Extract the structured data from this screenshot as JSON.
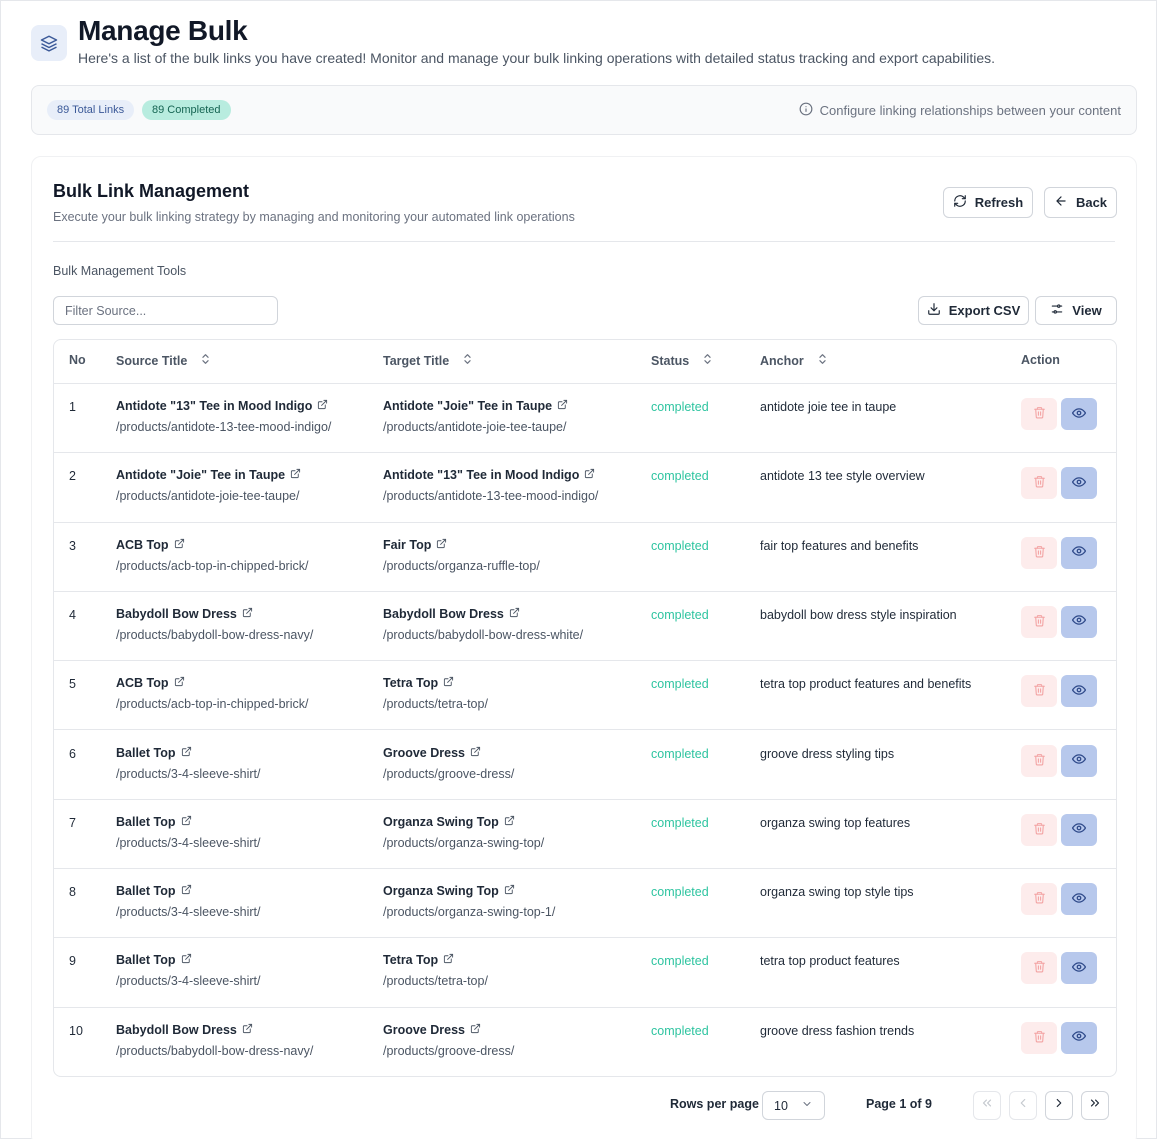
{
  "header": {
    "title": "Manage Bulk",
    "subtitle": "Here's a list of the bulk links you have created! Monitor and manage your bulk linking operations with detailed status tracking and export capabilities.",
    "icon": "layers-icon"
  },
  "stats": {
    "total_badge": "89 Total Links",
    "completed_badge": "89 Completed",
    "note": "Configure linking relationships between your content"
  },
  "card": {
    "title": "Bulk Link Management",
    "subtitle": "Execute your bulk linking strategy by managing and monitoring your automated link operations",
    "refresh_label": "Refresh",
    "back_label": "Back",
    "tools_label": "Bulk Management Tools",
    "filter_placeholder": "Filter Source...",
    "export_label": "Export CSV",
    "view_label": "View"
  },
  "table": {
    "columns": {
      "no": "No",
      "source": "Source Title",
      "target": "Target Title",
      "status": "Status",
      "anchor": "Anchor",
      "action": "Action"
    },
    "rows": [
      {
        "no": "1",
        "source_title": "Antidote \"13\" Tee in Mood Indigo",
        "source_url": "/products/antidote-13-tee-mood-indigo/",
        "target_title": "Antidote \"Joie\" Tee in Taupe",
        "target_url": "/products/antidote-joie-tee-taupe/",
        "status": "completed",
        "anchor": "antidote joie tee in taupe"
      },
      {
        "no": "2",
        "source_title": "Antidote \"Joie\" Tee in Taupe",
        "source_url": "/products/antidote-joie-tee-taupe/",
        "target_title": "Antidote \"13\" Tee in Mood Indigo",
        "target_url": "/products/antidote-13-tee-mood-indigo/",
        "status": "completed",
        "anchor": "antidote 13 tee style overview"
      },
      {
        "no": "3",
        "source_title": "ACB Top",
        "source_url": "/products/acb-top-in-chipped-brick/",
        "target_title": "Fair Top",
        "target_url": "/products/organza-ruffle-top/",
        "status": "completed",
        "anchor": "fair top features and benefits"
      },
      {
        "no": "4",
        "source_title": "Babydoll Bow Dress",
        "source_url": "/products/babydoll-bow-dress-navy/",
        "target_title": "Babydoll Bow Dress",
        "target_url": "/products/babydoll-bow-dress-white/",
        "status": "completed",
        "anchor": "babydoll bow dress style inspiration"
      },
      {
        "no": "5",
        "source_title": "ACB Top",
        "source_url": "/products/acb-top-in-chipped-brick/",
        "target_title": "Tetra Top",
        "target_url": "/products/tetra-top/",
        "status": "completed",
        "anchor": "tetra top product features and benefits"
      },
      {
        "no": "6",
        "source_title": "Ballet Top",
        "source_url": "/products/3-4-sleeve-shirt/",
        "target_title": "Groove Dress",
        "target_url": "/products/groove-dress/",
        "status": "completed",
        "anchor": "groove dress styling tips"
      },
      {
        "no": "7",
        "source_title": "Ballet Top",
        "source_url": "/products/3-4-sleeve-shirt/",
        "target_title": "Organza Swing Top",
        "target_url": "/products/organza-swing-top/",
        "status": "completed",
        "anchor": "organza swing top features"
      },
      {
        "no": "8",
        "source_title": "Ballet Top",
        "source_url": "/products/3-4-sleeve-shirt/",
        "target_title": "Organza Swing Top",
        "target_url": "/products/organza-swing-top-1/",
        "status": "completed",
        "anchor": "organza swing top style tips"
      },
      {
        "no": "9",
        "source_title": "Ballet Top",
        "source_url": "/products/3-4-sleeve-shirt/",
        "target_title": "Tetra Top",
        "target_url": "/products/tetra-top/",
        "status": "completed",
        "anchor": "tetra top product features"
      },
      {
        "no": "10",
        "source_title": "Babydoll Bow Dress",
        "source_url": "/products/babydoll-bow-dress-navy/",
        "target_title": "Groove Dress",
        "target_url": "/products/groove-dress/",
        "status": "completed",
        "anchor": "groove dress fashion trends"
      }
    ]
  },
  "pagination": {
    "rows_per_page_label": "Rows per page",
    "rows_per_page_value": "10",
    "page_info": "Page 1 of 9"
  },
  "colors": {
    "accent": "#3b5998",
    "status_completed": "#2ec4a0",
    "delete_bg": "#fdecec",
    "view_bg": "#b7c8ec"
  }
}
